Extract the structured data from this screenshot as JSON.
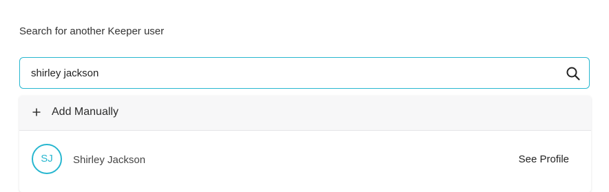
{
  "search": {
    "label": "Search for another Keeper user",
    "value": "shirley jackson",
    "icon": "search-icon"
  },
  "dropdown": {
    "add_manually": {
      "label": "Add Manually",
      "icon": "plus-icon"
    },
    "results": [
      {
        "initials": "SJ",
        "name": "Shirley Jackson",
        "action_label": "See Profile"
      }
    ]
  },
  "colors": {
    "accent": "#26b6cf",
    "row_bg": "#f7f7f8"
  }
}
